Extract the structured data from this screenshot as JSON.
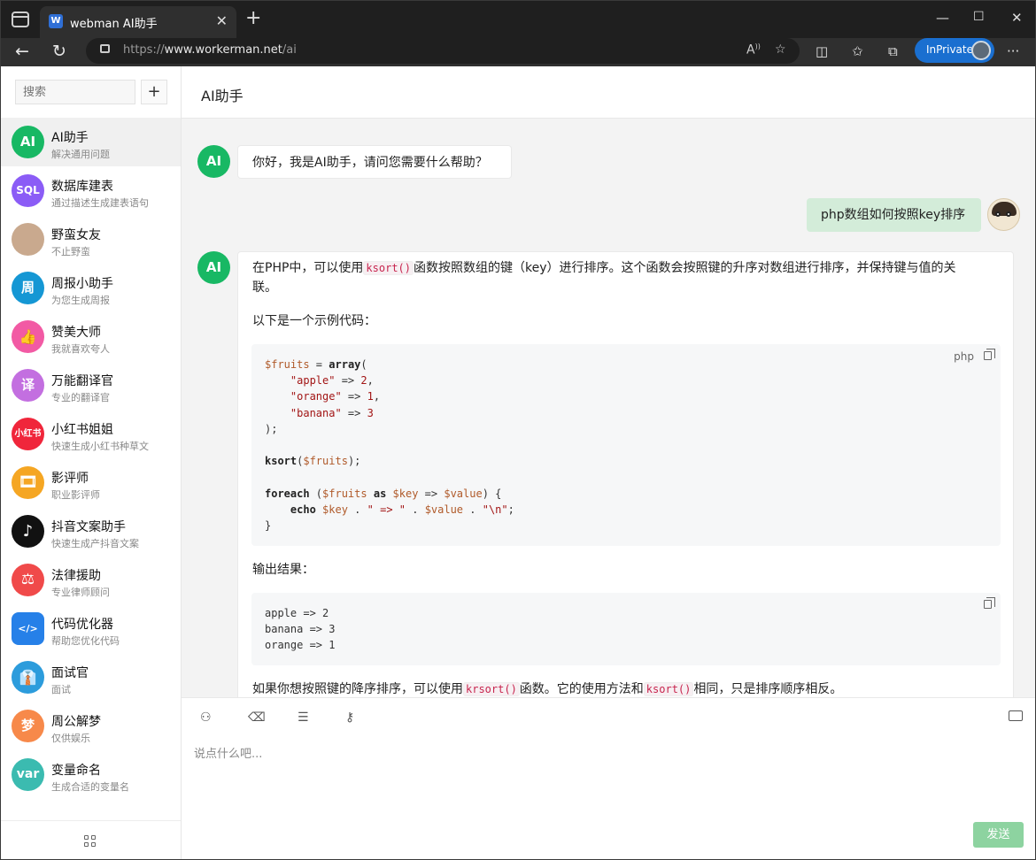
{
  "browser": {
    "tab_title": "webman AI助手",
    "tab_favicon": "W",
    "close_tab": "✕",
    "new_tab": "+",
    "url_prefix": "https://",
    "url_host": "www.workerman.net",
    "url_path": "/ai",
    "inprivate_label": "InPrivate"
  },
  "sidebar": {
    "search_placeholder": "搜索",
    "add_label": "+",
    "items": [
      {
        "name": "AI助手",
        "desc": "解决通用问题",
        "avatar": "AI",
        "color": "#18b864"
      },
      {
        "name": "数据库建表",
        "desc": "通过描述生成建表语句",
        "avatar": "SQL",
        "color": "#8b5cf6"
      },
      {
        "name": "野蛮女友",
        "desc": "不止野蛮",
        "avatar": "",
        "color": "#c9a98e"
      },
      {
        "name": "周报小助手",
        "desc": "为您生成周报",
        "avatar": "周",
        "color": "#1597d4"
      },
      {
        "name": "赞美大师",
        "desc": "我就喜欢夸人",
        "avatar": "👍",
        "color": "#f25aa4"
      },
      {
        "name": "万能翻译官",
        "desc": "专业的翻译官",
        "avatar": "译",
        "color": "#c36fe0"
      },
      {
        "name": "小红书姐姐",
        "desc": "快速生成小红书种草文",
        "avatar": "小红书",
        "color": "#f0263b"
      },
      {
        "name": "影评师",
        "desc": "职业影评师",
        "avatar": "🎞",
        "color": "#f5a623"
      },
      {
        "name": "抖音文案助手",
        "desc": "快速生成产抖音文案",
        "avatar": "♪",
        "color": "#111111"
      },
      {
        "name": "法律援助",
        "desc": "专业律师顾问",
        "avatar": "⚖",
        "color": "#f04a4a"
      },
      {
        "name": "代码优化器",
        "desc": "帮助您优化代码",
        "avatar": "</>",
        "color": "#2680e8"
      },
      {
        "name": "面试官",
        "desc": "面试",
        "avatar": "👔",
        "color": "#2c9cdc"
      },
      {
        "name": "周公解梦",
        "desc": "仅供娱乐",
        "avatar": "梦",
        "color": "#f7894a"
      },
      {
        "name": "变量命名",
        "desc": "生成合适的变量名",
        "avatar": "var",
        "color": "#3bbbb0"
      }
    ]
  },
  "main": {
    "title": "AI助手",
    "messages": {
      "greeting": "你好，我是AI助手，请问您需要什么帮助？",
      "user_question": "php数组如何按照key排序",
      "reply_p1_a": "在PHP中，可以使用",
      "reply_p1_code": "ksort()",
      "reply_p1_b": "函数按照数组的键（key）进行排序。这个函数会按照键的升序对数组进行排序，并保持键与值的关",
      "reply_p1_c": "联。",
      "reply_p2": "以下是一个示例代码：",
      "code_lang": "php",
      "reply_p3": "输出结果：",
      "output_lines": [
        "apple => 2",
        "banana => 3",
        "orange => 1"
      ],
      "reply_p4_a": "如果你想按照键的降序排序，可以使用",
      "reply_p4_code1": "krsort()",
      "reply_p4_b": "函数。它的使用方法和",
      "reply_p4_code2": "ksort()",
      "reply_p4_c": "相同，只是排序顺序相反。"
    },
    "composer_placeholder": "说点什么吧...",
    "send_label": "发送"
  }
}
